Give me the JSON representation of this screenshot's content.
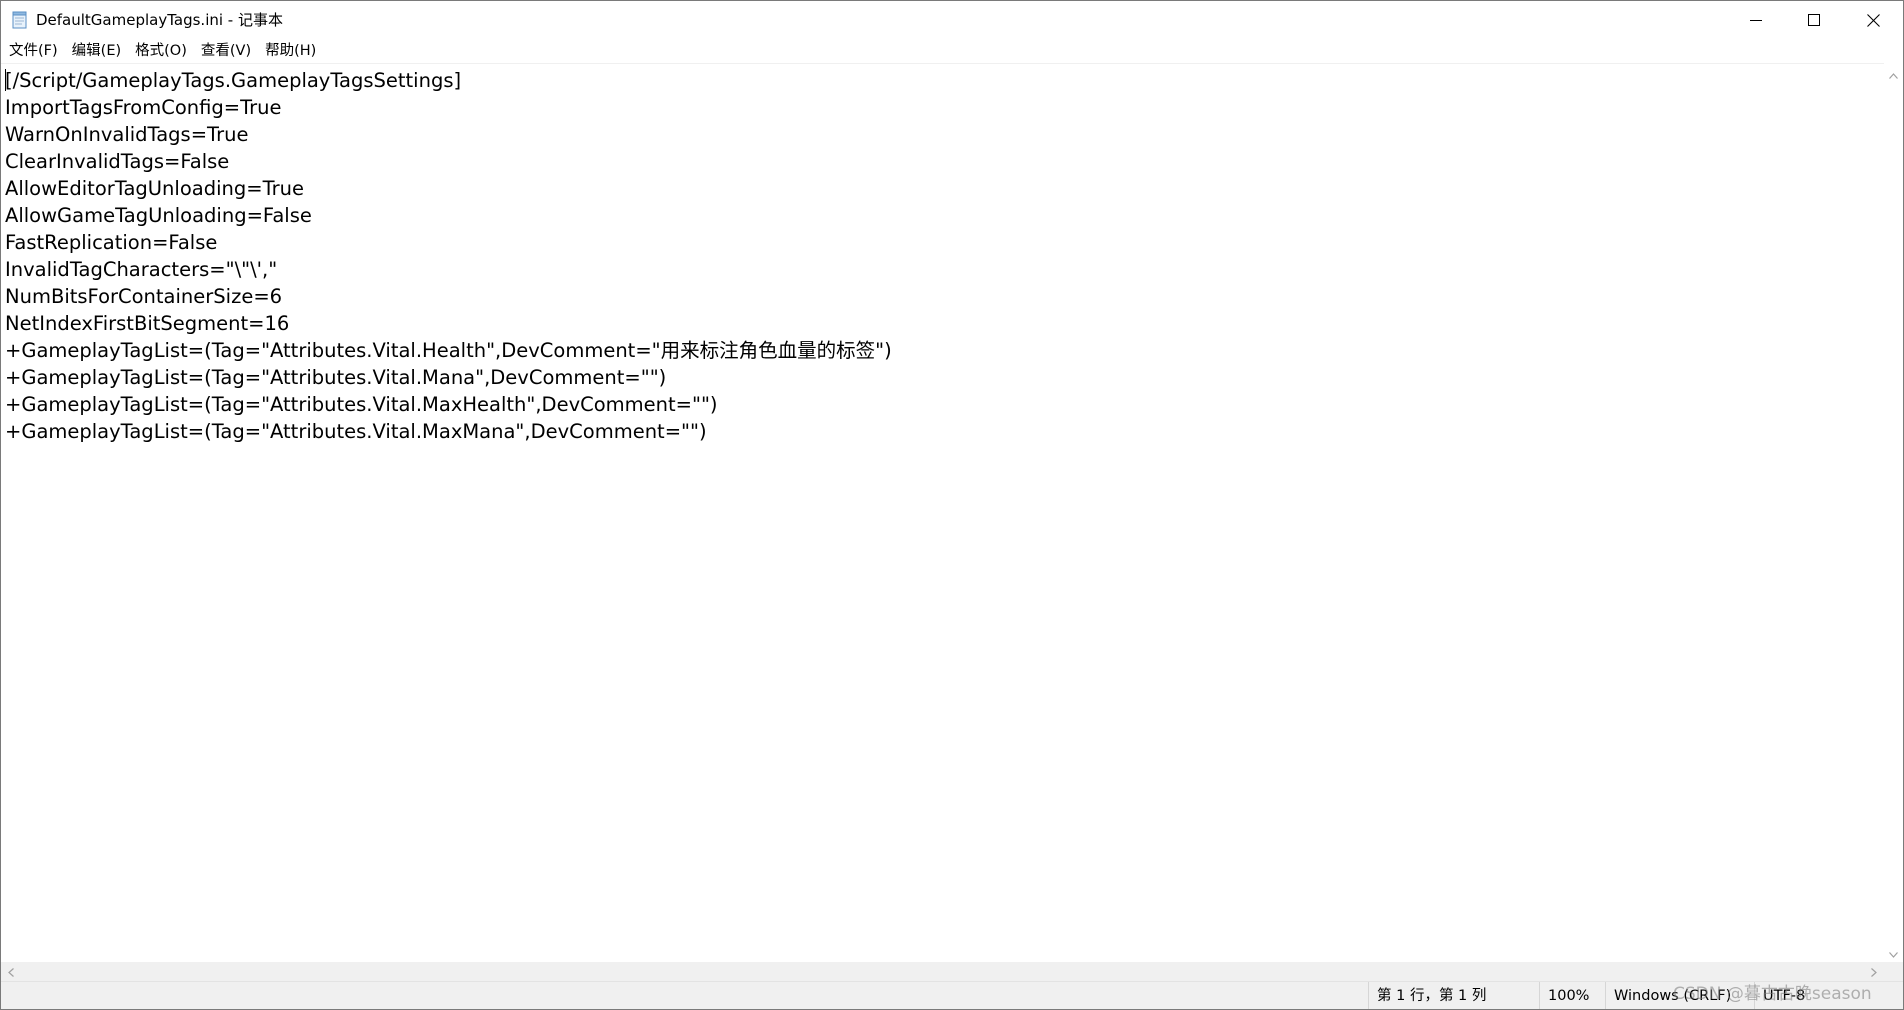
{
  "window": {
    "title": "DefaultGameplayTags.ini - 记事本"
  },
  "menu": {
    "items": [
      "文件(F)",
      "编辑(E)",
      "格式(O)",
      "查看(V)",
      "帮助(H)"
    ]
  },
  "editor": {
    "lines": [
      "[/Script/GameplayTags.GameplayTagsSettings]",
      "ImportTagsFromConfig=True",
      "WarnOnInvalidTags=True",
      "ClearInvalidTags=False",
      "AllowEditorTagUnloading=True",
      "AllowGameTagUnloading=False",
      "FastReplication=False",
      "InvalidTagCharacters=\"\\\"\\',\"",
      "NumBitsForContainerSize=6",
      "NetIndexFirstBitSegment=16",
      "+GameplayTagList=(Tag=\"Attributes.Vital.Health\",DevComment=\"用来标注角色血量的标签\")",
      "+GameplayTagList=(Tag=\"Attributes.Vital.Mana\",DevComment=\"\")",
      "+GameplayTagList=(Tag=\"Attributes.Vital.MaxHealth\",DevComment=\"\")",
      "+GameplayTagList=(Tag=\"Attributes.Vital.MaxMana\",DevComment=\"\")"
    ]
  },
  "statusbar": {
    "position": "第 1 行，第 1 列",
    "zoom": "100%",
    "line_ending": "Windows (CRLF)",
    "encoding": "UTF-8"
  },
  "watermark": "CSDN @暮古古晚season",
  "icons": {
    "app": "notepad-icon",
    "minimize": "minimize-icon",
    "maximize": "maximize-icon",
    "close": "close-icon"
  }
}
